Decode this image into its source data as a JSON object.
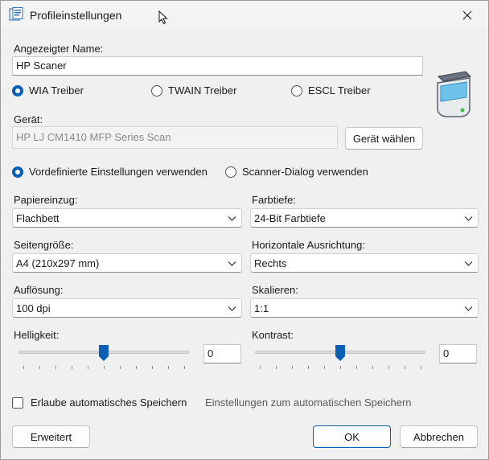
{
  "window": {
    "title": "Profileinstellungen"
  },
  "profile": {
    "display_name_label": "Angezeigter Name:",
    "display_name_value": "HP Scaner",
    "drivers": [
      {
        "label": "WIA Treiber",
        "selected": true
      },
      {
        "label": "TWAIN Treiber",
        "selected": false
      },
      {
        "label": "ESCL Treiber",
        "selected": false
      }
    ],
    "device_label": "Gerät:",
    "device_value": "HP LJ CM1410 MFP Series Scan",
    "choose_device_button": "Gerät wählen"
  },
  "mode": {
    "options": [
      {
        "label": "Vordefinierte Einstellungen verwenden",
        "selected": true
      },
      {
        "label": "Scanner-Dialog verwenden",
        "selected": false
      }
    ]
  },
  "settings": {
    "paper_feed": {
      "label": "Papiereinzug:",
      "value": "Flachbett"
    },
    "color_depth": {
      "label": "Farbtiefe:",
      "value": "24-Bit Farbtiefe"
    },
    "page_size": {
      "label": "Seitengröße:",
      "value": "A4 (210x297 mm)"
    },
    "orientation": {
      "label": "Horizontale Ausrichtung:",
      "value": "Rechts"
    },
    "resolution": {
      "label": "Auflösung:",
      "value": "100 dpi"
    },
    "scale": {
      "label": "Skalieren:",
      "value": "1:1"
    },
    "brightness": {
      "label": "Helligkeit:",
      "value": "0",
      "level": 0.5
    },
    "contrast": {
      "label": "Kontrast:",
      "value": "0",
      "level": 0.5
    }
  },
  "autosave": {
    "checkbox_label": "Erlaube automatisches Speichern",
    "checked": false,
    "settings_link": "Einstellungen zum automatischen Speichern"
  },
  "footer": {
    "advanced_button": "Erweitert",
    "ok_button": "OK",
    "cancel_button": "Abbrechen"
  },
  "colors": {
    "accent": "#0a5fb4"
  },
  "icons": [
    "app-profile-icon",
    "close-icon",
    "scanner-icon",
    "chevron-down-icon",
    "slider-thumb-icon"
  ]
}
